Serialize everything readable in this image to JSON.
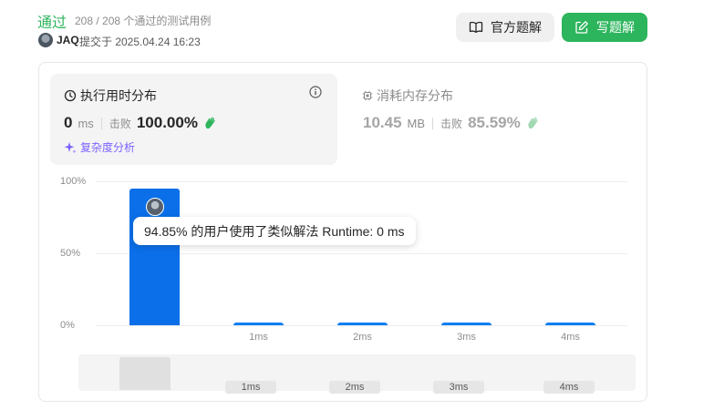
{
  "header": {
    "status": "通过",
    "testcases": "208 / 208 个通过的测试用例",
    "author": "JAQ",
    "submitted": "提交于 2025.04.24 16:23",
    "official_solution_label": "官方题解",
    "write_solution_label": "写题解"
  },
  "runtime": {
    "title": "执行用时分布",
    "value": "0",
    "unit": "ms",
    "beat_label": "击败",
    "beat_percent": "100.00%",
    "complexity_label": "复杂度分析"
  },
  "memory": {
    "title": "消耗内存分布",
    "value": "10.45",
    "unit": "MB",
    "beat_label": "击败",
    "beat_percent": "85.59%"
  },
  "tooltip": "94.85% 的用户使用了类似解法 Runtime: 0 ms",
  "colors": {
    "accent_green": "#2db55d",
    "bar_blue": "#0a6fe8",
    "complexity_purple": "#7b61ff"
  },
  "chart_data": {
    "type": "bar",
    "categories": [
      "0ms",
      "1ms",
      "2ms",
      "3ms",
      "4ms"
    ],
    "x_tick_labels": [
      "",
      "1ms",
      "2ms",
      "3ms",
      "4ms"
    ],
    "values": [
      94.85,
      2,
      2,
      2,
      2
    ],
    "y_tick_labels": [
      "100%",
      "50%",
      "0%"
    ],
    "ylim": [
      0,
      100
    ],
    "grid": true,
    "highlighted_category": "0ms"
  },
  "overview": {
    "ticks": [
      "1ms",
      "2ms",
      "3ms",
      "4ms"
    ]
  }
}
